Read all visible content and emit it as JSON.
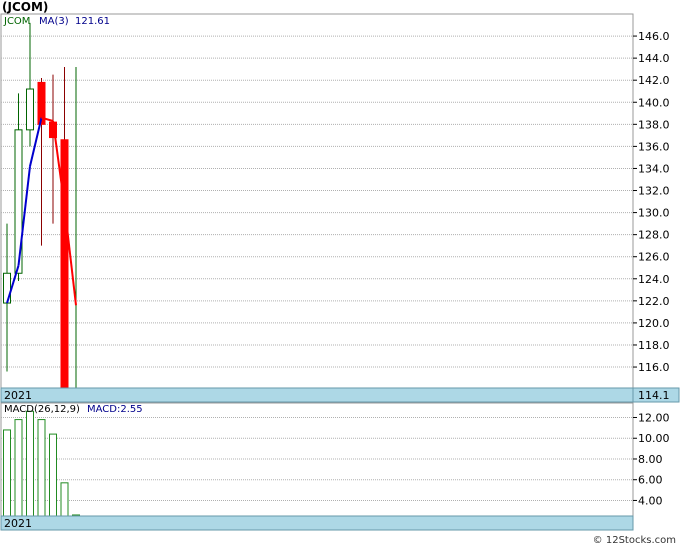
{
  "header": {
    "title": "(JCOM)"
  },
  "legend": {
    "symbol": "JCOM",
    "ma_label": "MA(3)",
    "ma_value": "121.61",
    "macd_label": "MACD(26,12,9)",
    "macd_value": "MACD:2.55"
  },
  "footer": {
    "year_top": "2021",
    "year_bottom": "2021",
    "last_price": "114.1",
    "watermark": "© 12Stocks.com"
  },
  "colors": {
    "up": "#006400",
    "down": "#ff0000",
    "ma_up": "#0000cd",
    "ma_down": "#ff0000",
    "band": "#add8e6",
    "grid": "#b0b0b0",
    "macd_bar": "#228b22",
    "label_blue": "#00008b"
  },
  "chart_data": [
    {
      "type": "candlestick",
      "ylim": [
        114.1,
        148
      ],
      "ticks": [
        116.0,
        118.0,
        120.0,
        122.0,
        124.0,
        126.0,
        128.0,
        130.0,
        132.0,
        134.0,
        136.0,
        138.0,
        140.0,
        142.0,
        144.0,
        146.0
      ],
      "tick_labels": [
        "116.0",
        "118.0",
        "120.0",
        "122.0",
        "124.0",
        "126.0",
        "128.0",
        "130.0",
        "132.0",
        "134.0",
        "136.0",
        "138.0",
        "140.0",
        "142.0",
        "144.0",
        "146.0"
      ],
      "candles": [
        {
          "open": 121.8,
          "high": 129.0,
          "low": 115.6,
          "close": 124.5
        },
        {
          "open": 124.5,
          "high": 140.8,
          "low": 123.8,
          "close": 137.5
        },
        {
          "open": 137.5,
          "high": 147.2,
          "low": 136.0,
          "close": 141.2
        },
        {
          "open": 141.8,
          "high": 142.2,
          "low": 127.0,
          "close": 138.0
        },
        {
          "open": 138.2,
          "high": 142.5,
          "low": 129.0,
          "close": 136.8
        },
        {
          "open": 136.6,
          "high": 143.2,
          "low": 114.1,
          "close": 114.1
        },
        {
          "open": 114.1,
          "high": 143.2,
          "low": 114.1,
          "close": 114.1
        }
      ],
      "ma": [
        121.8,
        125.2,
        134.2,
        138.6,
        138.3,
        130.6,
        121.6
      ]
    },
    {
      "type": "bar",
      "series_name": "MACD",
      "ylim": [
        2.5,
        13.4
      ],
      "ticks": [
        4.0,
        6.0,
        8.0,
        10.0,
        12.0
      ],
      "tick_labels": [
        "4.00",
        "6.00",
        "8.00",
        "10.00",
        "12.00"
      ],
      "values": [
        10.8,
        11.8,
        12.6,
        11.8,
        10.4,
        5.7,
        2.6
      ]
    }
  ]
}
